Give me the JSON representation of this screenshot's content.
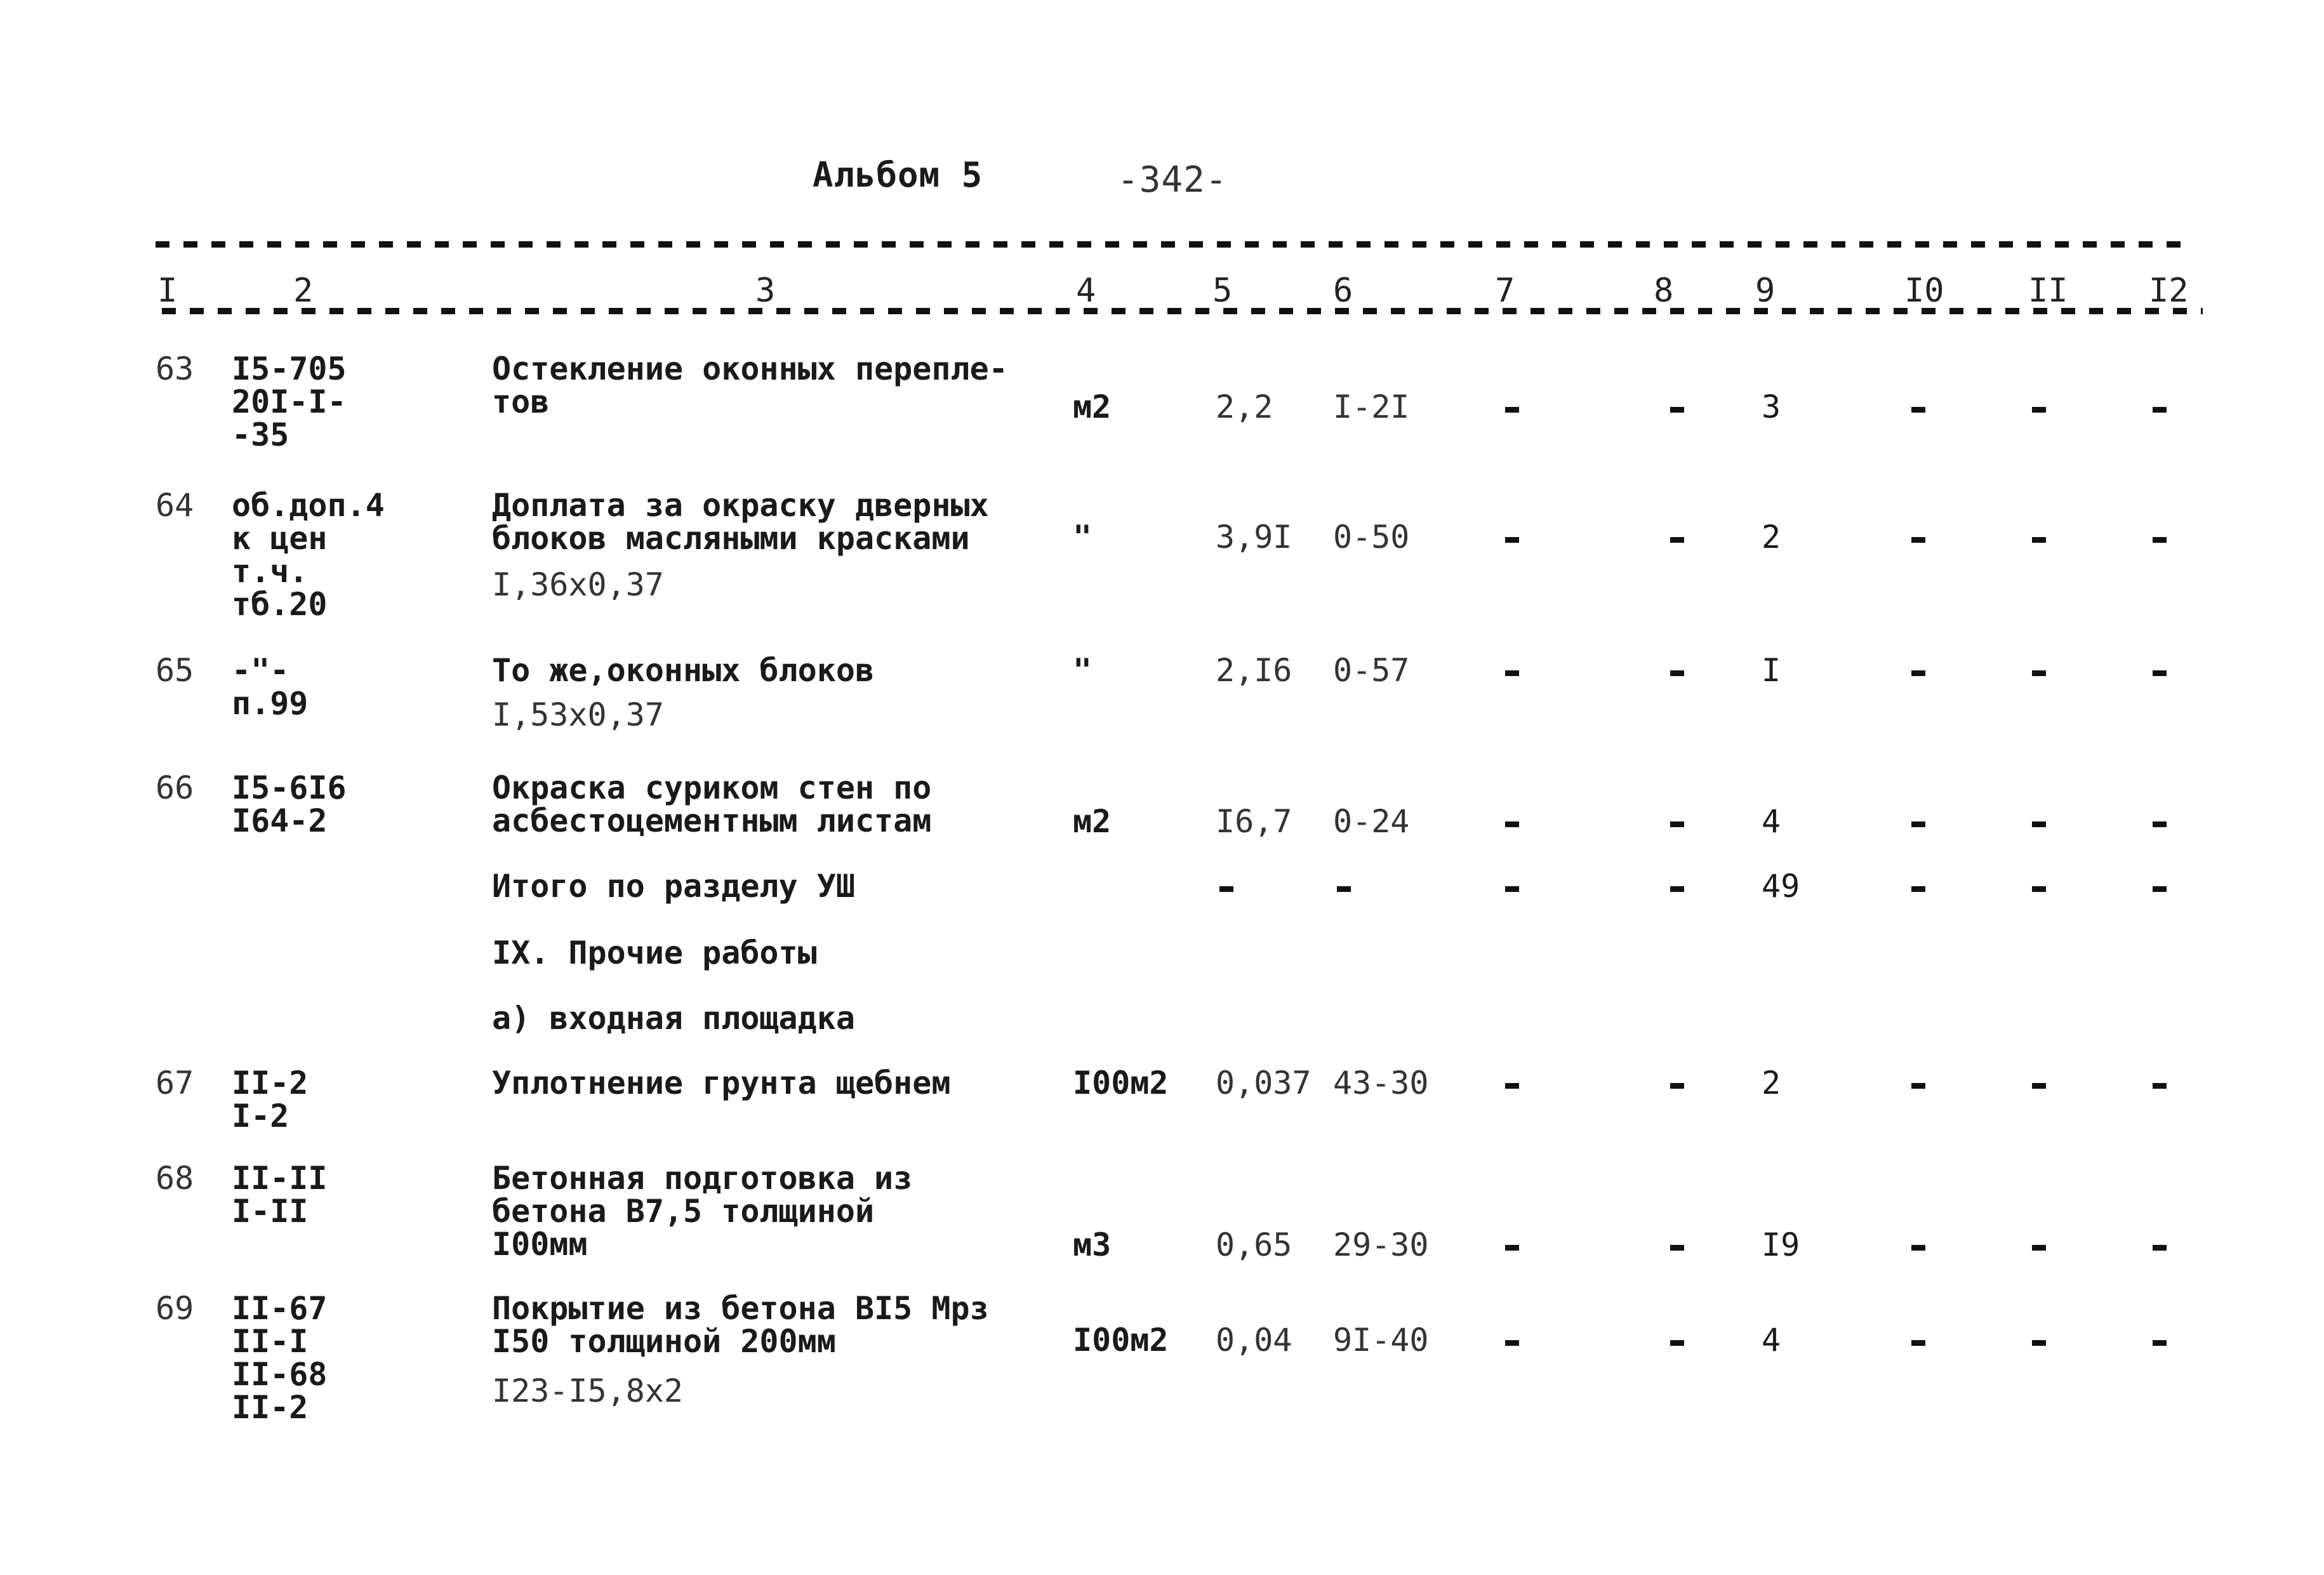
{
  "header": {
    "album": "Альбом 5",
    "page_number": "-342-"
  },
  "columns": [
    "I",
    "2",
    "3",
    "4",
    "5",
    "6",
    "7",
    "8",
    "9",
    "I0",
    "II",
    "I2"
  ],
  "rows": [
    {
      "num": "63",
      "code": [
        "I5-705",
        "20I-I-",
        "-35"
      ],
      "desc": [
        "Остекление оконных перепле-",
        "тов"
      ],
      "formula": "",
      "unit": "м2",
      "qty": "2,2",
      "price": "I-2I",
      "c7": "-",
      "c8": "-",
      "c9": "3",
      "c10": "-",
      "c11": "-",
      "c12": "-"
    },
    {
      "num": "64",
      "code": [
        "об.доп.4",
        "к цен",
        "т.ч.",
        "тб.20"
      ],
      "desc": [
        "Доплата за окраску дверных",
        "блоков масляными красками"
      ],
      "formula": "I,36х0,37",
      "unit": "\"",
      "qty": "3,9I",
      "price": "0-50",
      "c7": "-",
      "c8": "-",
      "c9": "2",
      "c10": "-",
      "c11": "-",
      "c12": "-"
    },
    {
      "num": "65",
      "code": [
        "-\"-",
        "п.99"
      ],
      "desc": [
        "То же,оконных блоков"
      ],
      "formula": "I,53х0,37",
      "unit": "\"",
      "qty": "2,I6",
      "price": "0-57",
      "c7": "-",
      "c8": "-",
      "c9": "I",
      "c10": "-",
      "c11": "-",
      "c12": "-"
    },
    {
      "num": "66",
      "code": [
        "I5-6I6",
        "I64-2"
      ],
      "desc": [
        "Окраска суриком стен по",
        "асбестоцементным листам"
      ],
      "formula": "",
      "unit": "м2",
      "qty": "I6,7",
      "price": "0-24",
      "c7": "-",
      "c8": "-",
      "c9": "4",
      "c10": "-",
      "c11": "-",
      "c12": "-"
    }
  ],
  "subtotal": {
    "label": "Итого по разделу УШ",
    "qty": "-",
    "price": "-",
    "c7": "-",
    "c8": "-",
    "c9": "49",
    "c10": "-",
    "c11": "-",
    "c12": "-"
  },
  "section": {
    "title": "IX. Прочие работы",
    "subtitle": "а) входная площадка"
  },
  "rows2": [
    {
      "num": "67",
      "code": [
        "II-2",
        "I-2"
      ],
      "desc": [
        "Уплотнение грунта щебнем"
      ],
      "formula": "",
      "unit": "I00м2",
      "qty": "0,037",
      "price": "43-30",
      "c7": "-",
      "c8": "-",
      "c9": "2",
      "c10": "-",
      "c11": "-",
      "c12": "-"
    },
    {
      "num": "68",
      "code": [
        "II-II",
        "I-II"
      ],
      "desc": [
        "Бетонная подготовка из",
        "бетона В7,5 толщиной",
        "I00мм"
      ],
      "formula": "",
      "unit": "м3",
      "qty": "0,65",
      "price": "29-30",
      "c7": "-",
      "c8": "-",
      "c9": "I9",
      "c10": "-",
      "c11": "-",
      "c12": "-"
    },
    {
      "num": "69",
      "code": [
        "II-67",
        "II-I",
        "II-68",
        "II-2"
      ],
      "desc": [
        "Покрытие из бетона ВI5 Мрз",
        "I50 толщиной 200мм"
      ],
      "formula": "I23-I5,8х2",
      "unit": "I00м2",
      "qty": "0,04",
      "price": "9I-40",
      "c7": "-",
      "c8": "-",
      "c9": "4",
      "c10": "-",
      "c11": "-",
      "c12": "-"
    }
  ]
}
